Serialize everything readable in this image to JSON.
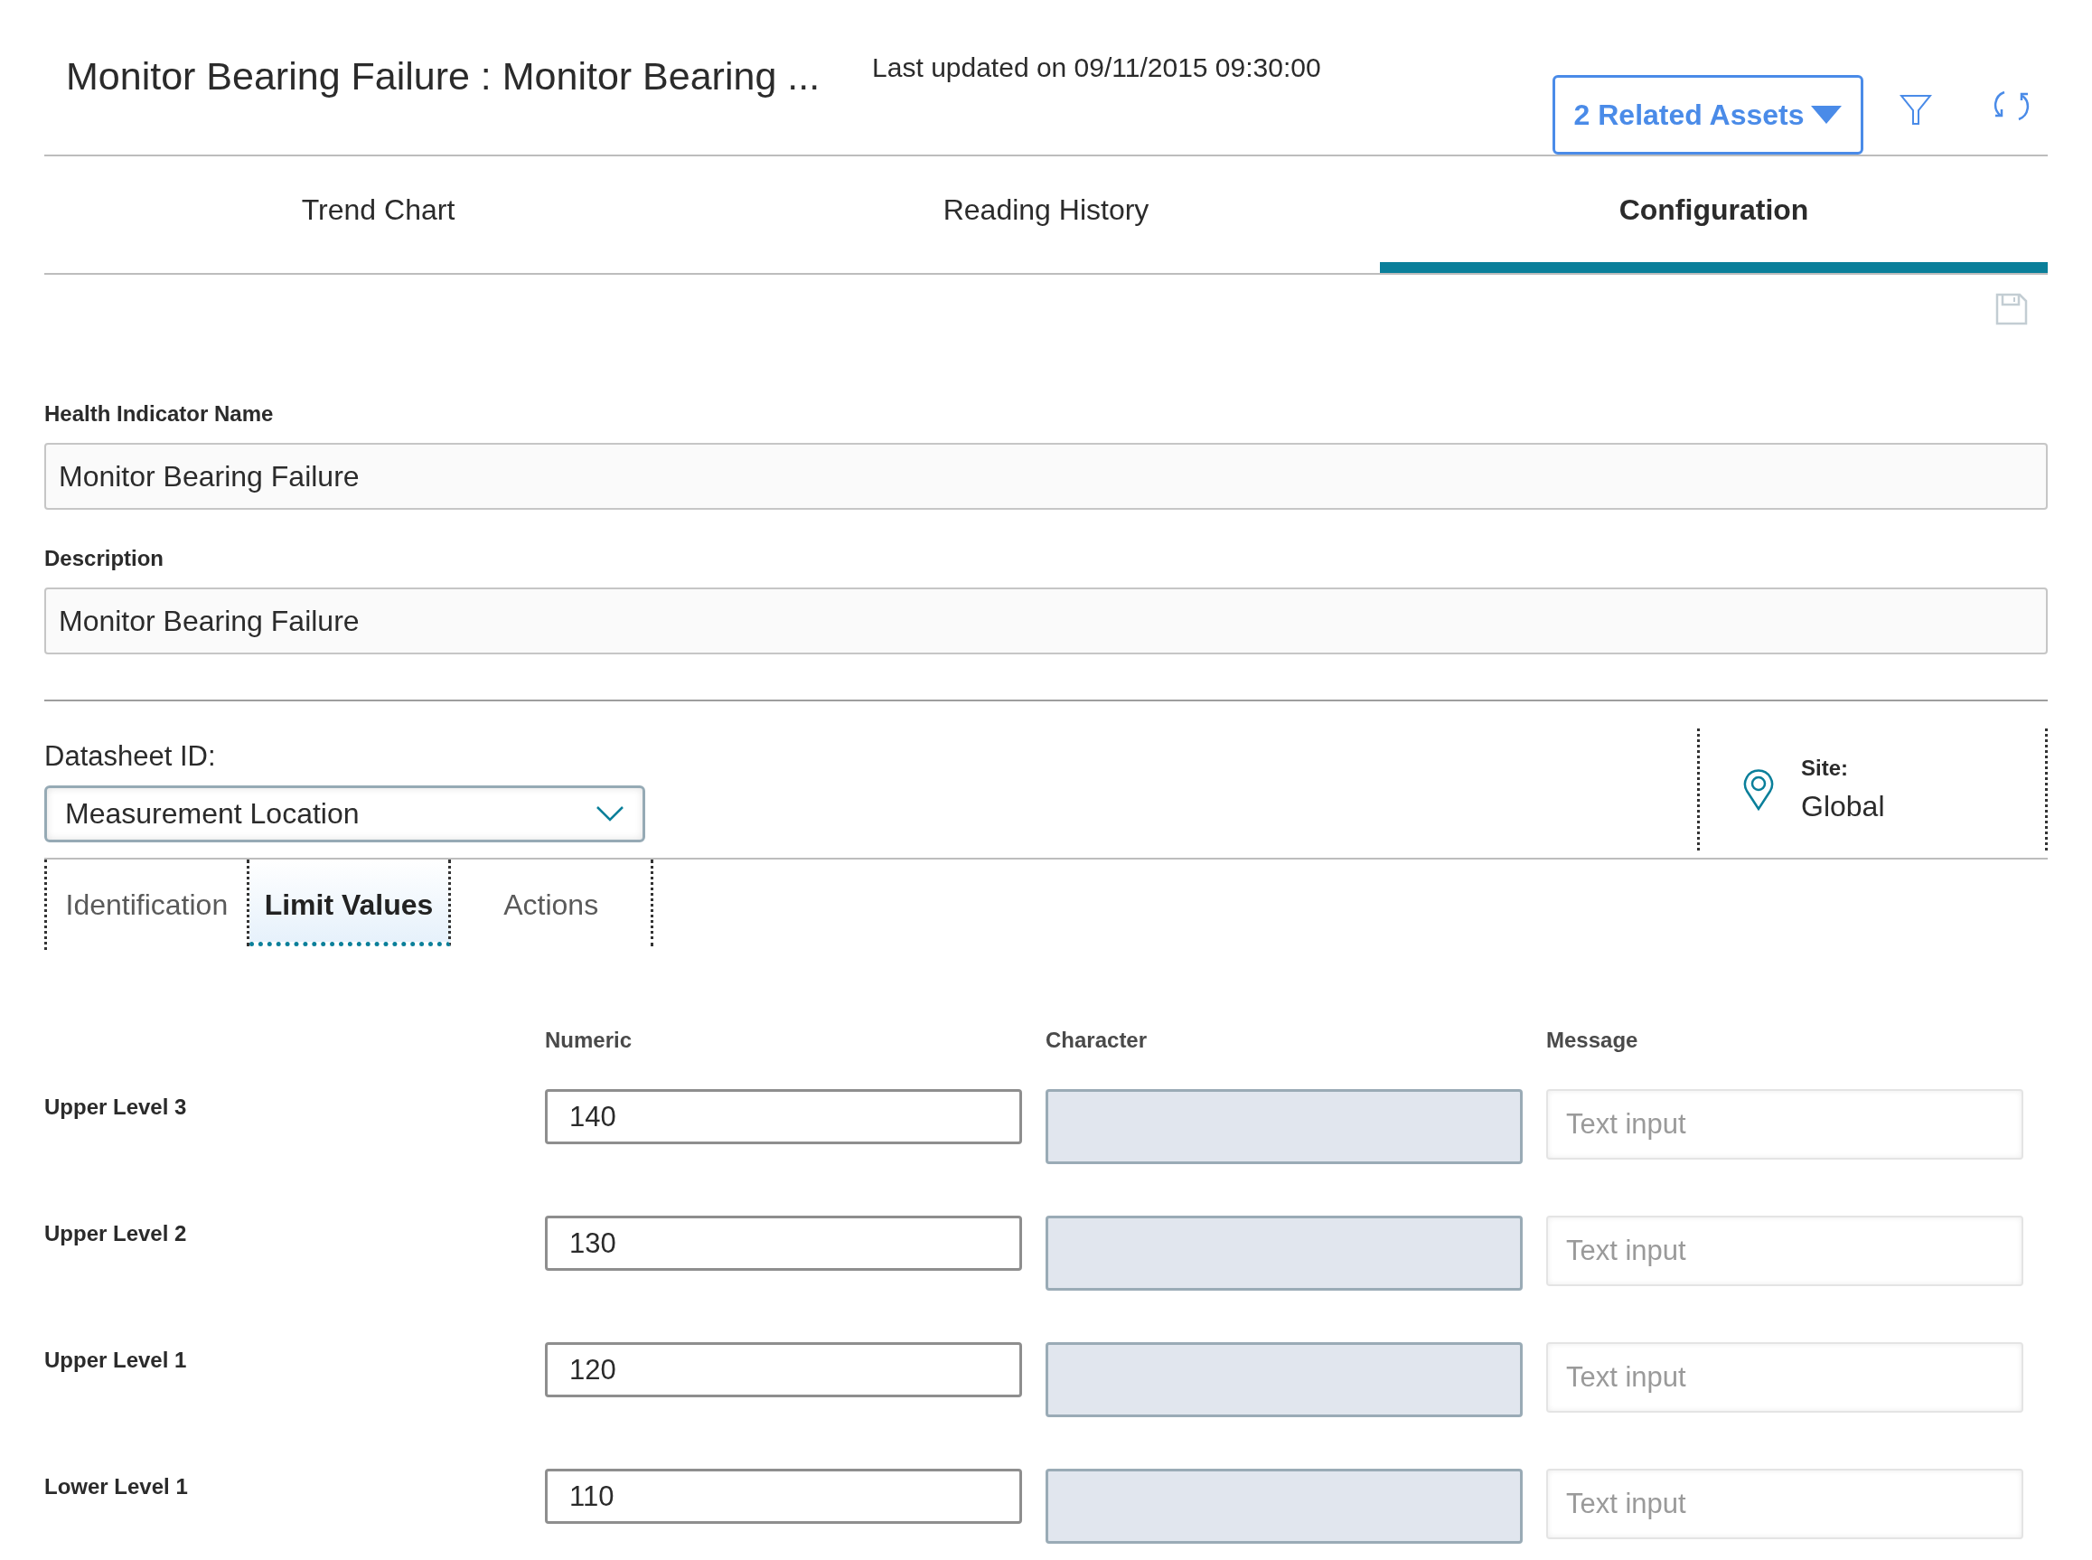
{
  "header": {
    "title": "Monitor Bearing Failure : Monitor Bearing ...",
    "last_updated": "Last updated on 09/11/2015 09:30:00",
    "related_assets_button": "2 Related Assets"
  },
  "tabs": [
    {
      "label": "Trend Chart",
      "selected": false
    },
    {
      "label": "Reading History",
      "selected": false
    },
    {
      "label": "Configuration",
      "selected": true
    }
  ],
  "fields": [
    {
      "label": "Health Indicator Name",
      "value": "Monitor Bearing Failure"
    },
    {
      "label": "Description",
      "value": "Monitor Bearing Failure"
    }
  ],
  "datasheet": {
    "label": "Datasheet ID:",
    "value": "Measurement Location"
  },
  "site": {
    "label": "Site:",
    "value": "Global"
  },
  "sub_tabs": [
    {
      "label": "Identification",
      "selected": false
    },
    {
      "label": "Limit Values",
      "selected": true
    },
    {
      "label": "Actions",
      "selected": false
    }
  ],
  "limit_table": {
    "columns": [
      "Numeric",
      "Character",
      "Message"
    ],
    "rows": [
      {
        "label": "Upper Level 3",
        "numeric": "140",
        "character_disabled": true,
        "message_placeholder": "Text input"
      },
      {
        "label": "Upper Level 2",
        "numeric": "130",
        "character_disabled": true,
        "message_placeholder": "Text input"
      },
      {
        "label": "Upper Level 1",
        "numeric": "120",
        "character_disabled": true,
        "message_placeholder": "Text input"
      },
      {
        "label": "Lower Level 1",
        "numeric": "110",
        "character_disabled": true,
        "message_placeholder": "Text input"
      }
    ]
  }
}
